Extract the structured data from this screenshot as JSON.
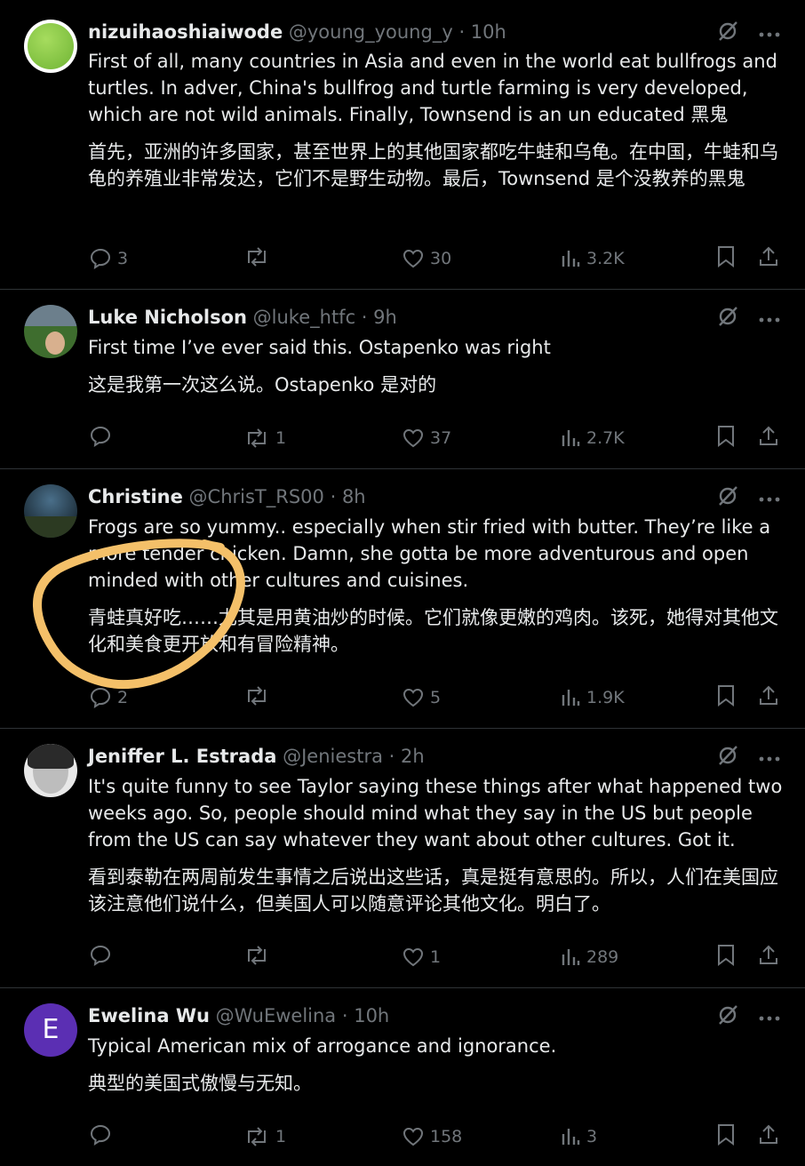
{
  "tweets": [
    {
      "name": "nizuihaoshiaiwode",
      "handle": "@young_young_y",
      "time": "10h",
      "text_en": "First of all, many countries in Asia and even in the world eat bullfrogs and turtles. In adver, China's bullfrog and turtle farming is very developed, which are not wild animals. Finally, Townsend is an un educated 黑鬼",
      "text_zh": "首先，亚洲的许多国家，甚至世界上的其他国家都吃牛蛙和乌龟。在中国，牛蛙和乌龟的养殖业非常发达，它们不是野生动物。最后，Townsend 是个没教养的黑鬼",
      "replies": "3",
      "reposts": "",
      "likes": "30",
      "views": "3.2K",
      "avatar_color": "#7cc24a"
    },
    {
      "name": "Luke Nicholson",
      "handle": "@luke_htfc",
      "time": "9h",
      "text_en": "First time I’ve ever said this. Ostapenko was right",
      "text_zh": "这是我第一次这么说。Ostapenko 是对的",
      "replies": "",
      "reposts": "1",
      "likes": "37",
      "views": "2.7K",
      "avatar_color": "#4f7a3a"
    },
    {
      "name": "Christine",
      "handle": "@ChrisT_RS00",
      "time": "8h",
      "text_en": "Frogs are so yummy.. especially when stir fried with butter. They’re like a more tender chicken. Damn, she gotta be more adventurous and open minded with other cultures and cuisines.",
      "text_zh": "青蛙真好吃……尤其是用黄油炒的时候。它们就像更嫩的鸡肉。该死，她得对其他文化和美食更开放和有冒险精神。",
      "replies": "2",
      "reposts": "",
      "likes": "5",
      "views": "1.9K",
      "avatar_color": "#2f4a58"
    },
    {
      "name": "Jeniffer L. Estrada",
      "handle": "@Jeniestra",
      "time": "2h",
      "text_en": "It's quite funny to see Taylor saying these things after what happened two weeks ago. So, people should mind what they say in the US but people from the US can say whatever they want about other cultures. Got it.",
      "text_zh": "看到泰勒在两周前发生事情之后说出这些话，真是挺有意思的。所以，人们在美国应该注意他们说什么，但美国人可以随意评论其他文化。明白了。",
      "replies": "",
      "reposts": "",
      "likes": "1",
      "views": "289",
      "avatar_color": "#9a9a9a"
    },
    {
      "name": "Ewelina Wu",
      "handle": "@WuEwelina",
      "time": "10h",
      "avatar_letter": "E",
      "text_en": "Typical American mix of arrogance and ignorance.",
      "text_zh": "典型的美国式傲慢与无知。",
      "replies": "",
      "reposts": "1",
      "likes": "158",
      "views": "3",
      "avatar_color": "#5b2fb3"
    }
  ],
  "separator": " · ",
  "highlight_color": "#f4c069"
}
